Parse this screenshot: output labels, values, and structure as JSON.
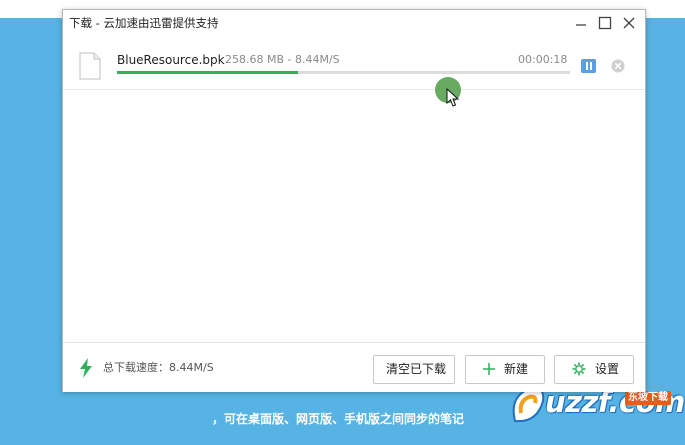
{
  "background": {
    "caption": "，可在桌面版、网页版、手机版之间同步的笔记",
    "watermark_text": "uzzf.com",
    "watermark_tag": "东坡下载"
  },
  "window": {
    "title": "下载 - 云加速由迅雷提供支持",
    "controls": {
      "minimize": "minimize-icon",
      "maximize": "maximize-icon",
      "close": "close-icon"
    }
  },
  "task": {
    "file_name": "BlueResource.bpk",
    "size_speed": "258.68 MB - 8.44M/S",
    "time_remaining": "00:00:18",
    "progress": 0.4,
    "icons": {
      "file": "document-icon",
      "pause": "pause-icon",
      "cancel": "cancel-icon"
    }
  },
  "footer": {
    "speed_label": "总下载速度：8.44M/S",
    "buttons": {
      "clear": "清空已下载",
      "new": "新建",
      "settings": "设置"
    }
  },
  "colors": {
    "accent_green": "#2fb15c",
    "pause_blue": "#5aa0e0",
    "background_blue": "#57b3e3"
  }
}
